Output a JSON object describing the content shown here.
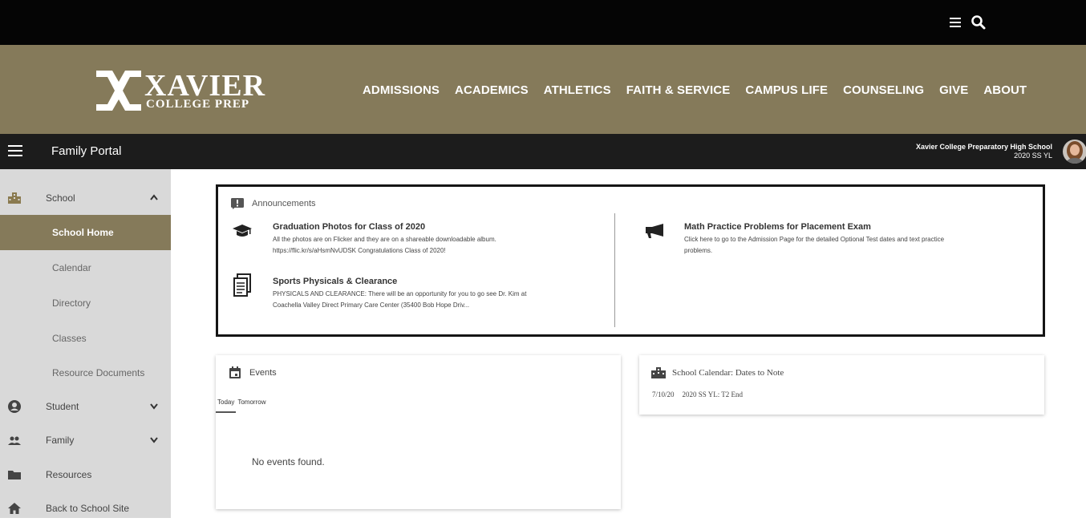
{
  "colors": {
    "brand": "#857a5a",
    "topbar": "#050505",
    "portalbar": "#1c1c1c",
    "sidebar": "#d9d9d9",
    "active": "#857a5a"
  },
  "topbar": {
    "menu_icon": "hamburger-icon",
    "search_icon": "search-icon"
  },
  "logo": {
    "line1": "XAVIER",
    "line2": "COLLEGE PREP"
  },
  "mainnav": [
    "ADMISSIONS",
    "ACADEMICS",
    "ATHLETICS",
    "FAITH & SERVICE",
    "CAMPUS LIFE",
    "COUNSELING",
    "GIVE",
    "ABOUT"
  ],
  "portal": {
    "title": "Family Portal",
    "school_name": "Xavier College Preparatory High School",
    "school_year": "2020 SS YL"
  },
  "sidebar": {
    "school": "School",
    "school_home": "School Home",
    "calendar": "Calendar",
    "directory": "Directory",
    "classes": "Classes",
    "resource_documents": "Resource Documents",
    "student": "Student",
    "family": "Family",
    "resources": "Resources",
    "back": "Back to School Site"
  },
  "announcements": {
    "heading": "Announcements",
    "items": [
      {
        "title": "Graduation Photos for Class of 2020",
        "line1": "All the photos are on Flicker and they are on a shareable downloadable album.",
        "line2": "https://flic.kr/s/aHsmNvUDSK Congratulations Class of 2020!",
        "icon": "graduation-cap-icon"
      },
      {
        "title": "Sports Physicals & Clearance",
        "line1": "PHYSICALS AND CLEARANCE: There will be an opportunity for you to go see Dr. Kim at",
        "line2": "Coachella Valley Direct Primary Care Center (35400 Bob Hope Driv...",
        "icon": "document-icon"
      },
      {
        "title": "Math Practice Problems for Placement Exam",
        "line1": "Click here to go to the Admission Page for the detailed Optional Test dates and text practice",
        "line2": "problems.",
        "icon": "megaphone-icon"
      }
    ]
  },
  "events": {
    "heading": "Events",
    "tab_today": "Today",
    "tab_tomorrow": "Tomorrow",
    "empty": "No events found."
  },
  "calendar": {
    "heading": "School Calendar: Dates to Note",
    "date": "7/10/20",
    "text": "2020 SS YL: T2 End"
  }
}
